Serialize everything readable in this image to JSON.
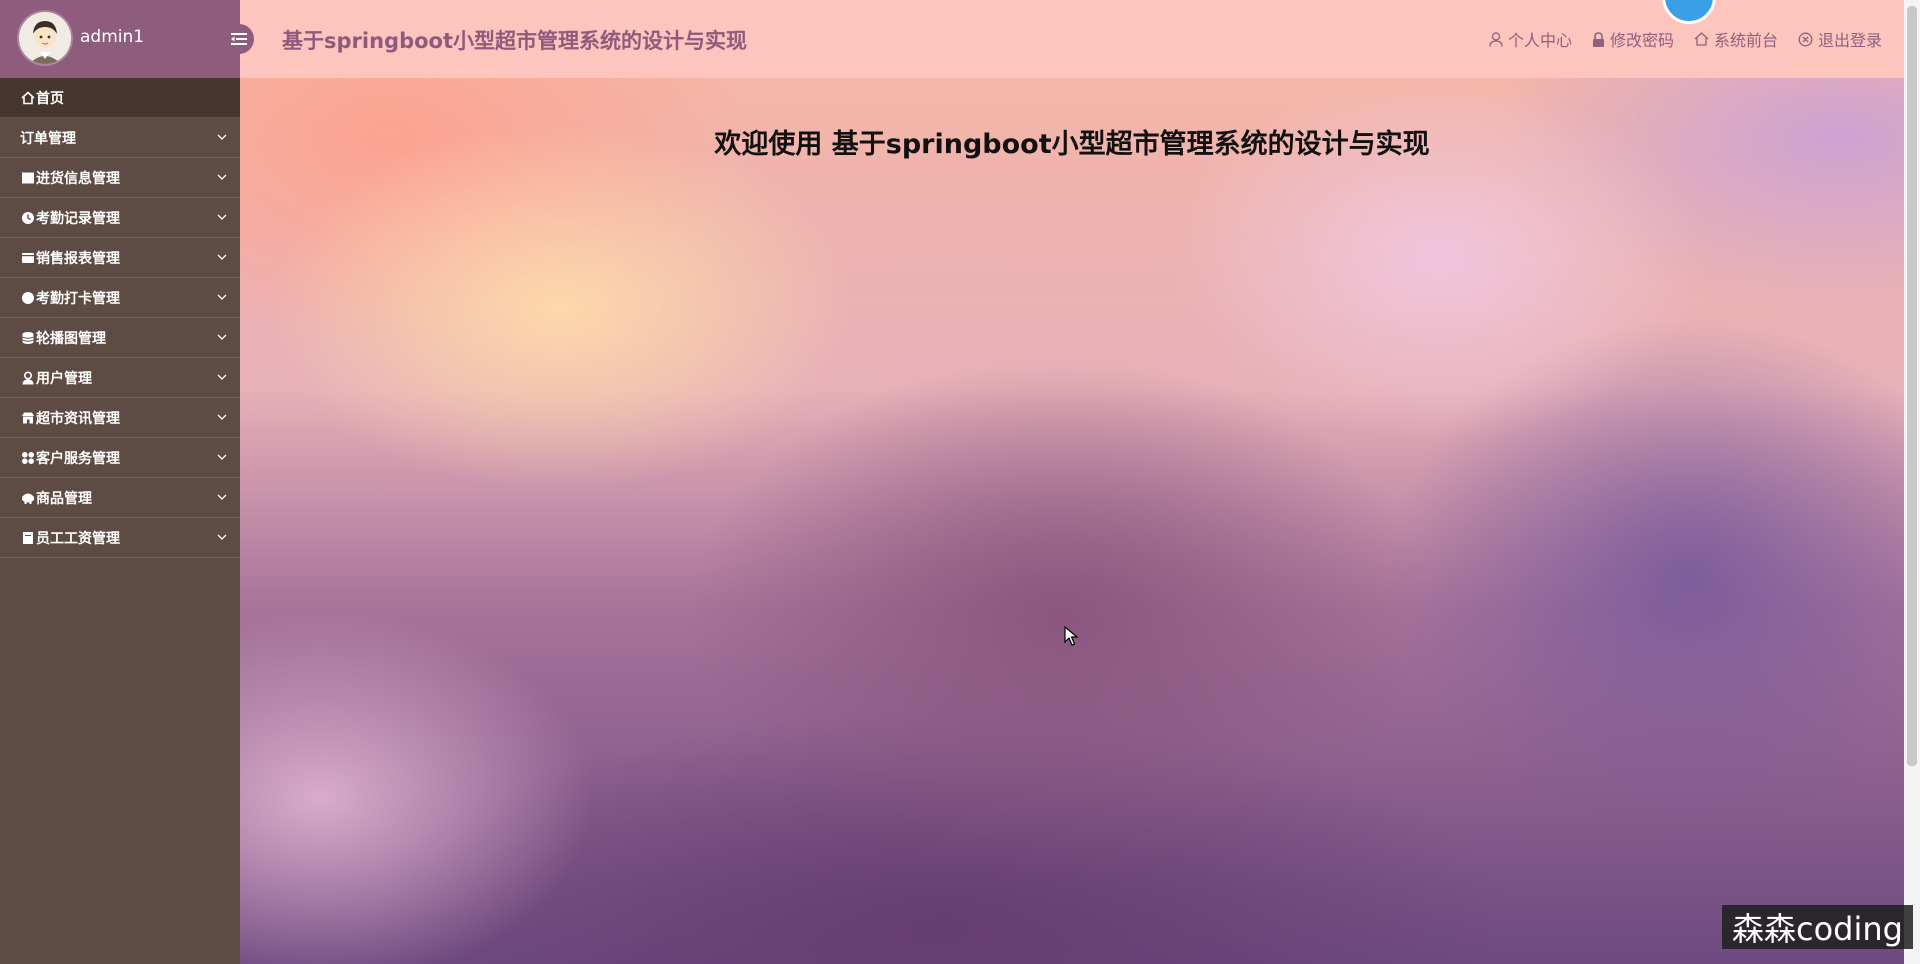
{
  "user": {
    "name": "admin1"
  },
  "header": {
    "title": "基于springboot小型超市管理系统的设计与实现",
    "links": [
      {
        "label": "个人中心",
        "icon": "user-icon"
      },
      {
        "label": "修改密码",
        "icon": "lock-icon"
      },
      {
        "label": "系统前台",
        "icon": "home-icon"
      },
      {
        "label": "退出登录",
        "icon": "close-circle-icon"
      }
    ]
  },
  "sidebar": {
    "items": [
      {
        "label": "首页",
        "icon": "home-icon",
        "active": true,
        "has_children": false
      },
      {
        "label": "订单管理",
        "icon": "",
        "active": false,
        "has_children": true
      },
      {
        "label": "进货信息管理",
        "icon": "square-icon",
        "active": false,
        "has_children": true
      },
      {
        "label": "考勤记录管理",
        "icon": "clock-icon",
        "active": false,
        "has_children": true
      },
      {
        "label": "销售报表管理",
        "icon": "card-icon",
        "active": false,
        "has_children": true
      },
      {
        "label": "考勤打卡管理",
        "icon": "circle-icon",
        "active": false,
        "has_children": true
      },
      {
        "label": "轮播图管理",
        "icon": "database-icon",
        "active": false,
        "has_children": true
      },
      {
        "label": "用户管理",
        "icon": "user-icon",
        "active": false,
        "has_children": true
      },
      {
        "label": "超市资讯管理",
        "icon": "shop-icon",
        "active": false,
        "has_children": true
      },
      {
        "label": "客户服务管理",
        "icon": "grid-icon",
        "active": false,
        "has_children": true
      },
      {
        "label": "商品管理",
        "icon": "goods-icon",
        "active": false,
        "has_children": true
      },
      {
        "label": "员工工资管理",
        "icon": "document-icon",
        "active": false,
        "has_children": true
      }
    ]
  },
  "main": {
    "welcome": "欢迎使用 基于springboot小型超市管理系统的设计与实现"
  },
  "watermark": "森森coding",
  "colors": {
    "sidebar_bg": "#5e4b44",
    "sidebar_head": "#8e5d7e",
    "header_bg": "#fec4be",
    "title_color": "#8f5a7c"
  }
}
